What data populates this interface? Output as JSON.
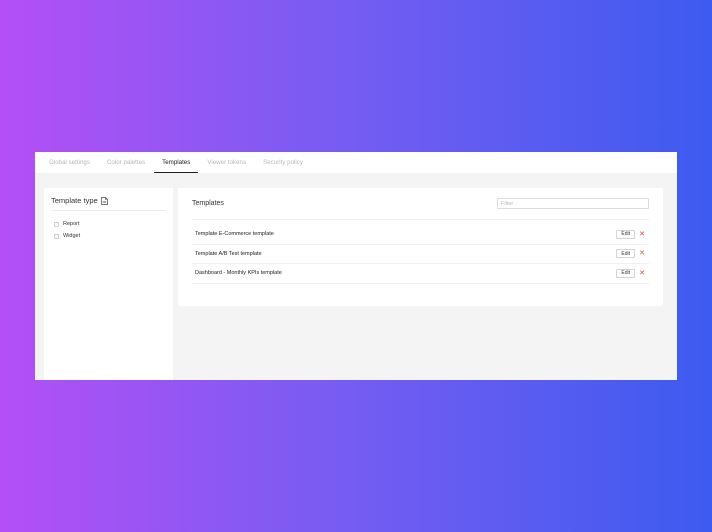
{
  "tabs": [
    {
      "label": "Global settings",
      "active": false
    },
    {
      "label": "Color palettes",
      "active": false
    },
    {
      "label": "Templates",
      "active": true
    },
    {
      "label": "Viewer tokens",
      "active": false
    },
    {
      "label": "Security policy",
      "active": false
    }
  ],
  "sidebar": {
    "title": "Template type",
    "title_icon": "document-icon",
    "options": [
      {
        "label": "Report",
        "checked": false
      },
      {
        "label": "Widget",
        "checked": false
      }
    ]
  },
  "panel": {
    "title": "Templates",
    "filter_placeholder": "Filter",
    "filter_value": "",
    "edit_label": "Edit",
    "delete_icon": "close-icon",
    "delete_color": "#e24a3b",
    "rows": [
      {
        "label": "Template E-Commerce template"
      },
      {
        "label": "Template A/B Test template"
      },
      {
        "label": "Dashboard - Monthly KPIs template"
      }
    ]
  }
}
